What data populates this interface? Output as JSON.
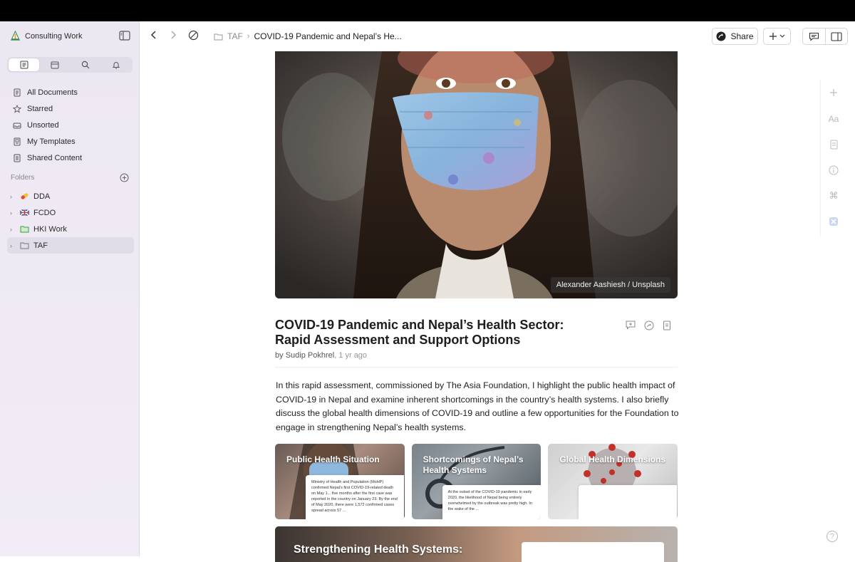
{
  "app": {
    "workspace": "Consulting Work"
  },
  "sidebar": {
    "tabs": [
      {
        "icon": "document-list-icon",
        "active": true
      },
      {
        "icon": "calendar-icon",
        "active": false
      },
      {
        "icon": "search-icon",
        "active": false
      },
      {
        "icon": "bell-icon",
        "active": false
      }
    ],
    "nav": [
      {
        "label": "All Documents",
        "icon": "documents-icon"
      },
      {
        "label": "Starred",
        "icon": "star-icon"
      },
      {
        "label": "Unsorted",
        "icon": "inbox-icon"
      },
      {
        "label": "My Templates",
        "icon": "template-icon"
      },
      {
        "label": "Shared Content",
        "icon": "shared-icon"
      }
    ],
    "folders_heading": "Folders",
    "folders": [
      {
        "label": "DDA",
        "icon": "pill-emoji-icon"
      },
      {
        "label": "FCDO",
        "icon": "uk-flag-icon"
      },
      {
        "label": "HKI Work",
        "icon": "green-folder-icon"
      },
      {
        "label": "TAF",
        "icon": "folder-icon",
        "selected": true
      }
    ]
  },
  "header": {
    "breadcrumb_folder": "TAF",
    "breadcrumb_separator": "›",
    "breadcrumb_current": "COVID-19 Pandemic and Nepal’s He...",
    "share_label": "Share"
  },
  "document": {
    "image_credit": "Alexander Aashiesh / Unsplash",
    "title": "COVID-19 Pandemic and Nepal’s Health Sector: Rapid Assessment and Support Options",
    "author_prefix": "by ",
    "author": "Sudip Pokhrel",
    "age": ", 1 yr ago",
    "abstract": "In this rapid assessment, commissioned by The Asia Foundation, I highlight the public health impact of COVID-19 in Nepal and examine inherent shortcomings in the country’s health systems. I also briefly discuss the global health dimensions of COVID-19 and outline a few opportunities for the Foundation to engage in strengthening Nepal’s health systems.",
    "cards": [
      {
        "title": "Public Health Situation",
        "snippet": "Ministry of Health and Population (MoHP) confirmed Nepal's first COVID-19-related death on May 1... five months after the first case was reported in the country on January 23. By the end of May 2020, there were 1,572 confirmed cases spread across 57 ..."
      },
      {
        "title": "Shortcomings of Nepal’s Health Systems",
        "snippet": "At the outset of the COVID-19 pandemic in early 2020, the likelihood of Nepal being entirely overwhelmed by the outbreak was pretty high. In the wake of the ..."
      },
      {
        "title": "Global Health Dimensions",
        "snippet": ""
      }
    ],
    "bottom_card_title": "Strengthening Health Systems:"
  },
  "colors": {
    "sidebar_bg": "#ece8f2",
    "accent_text": "#1d1d1f"
  }
}
